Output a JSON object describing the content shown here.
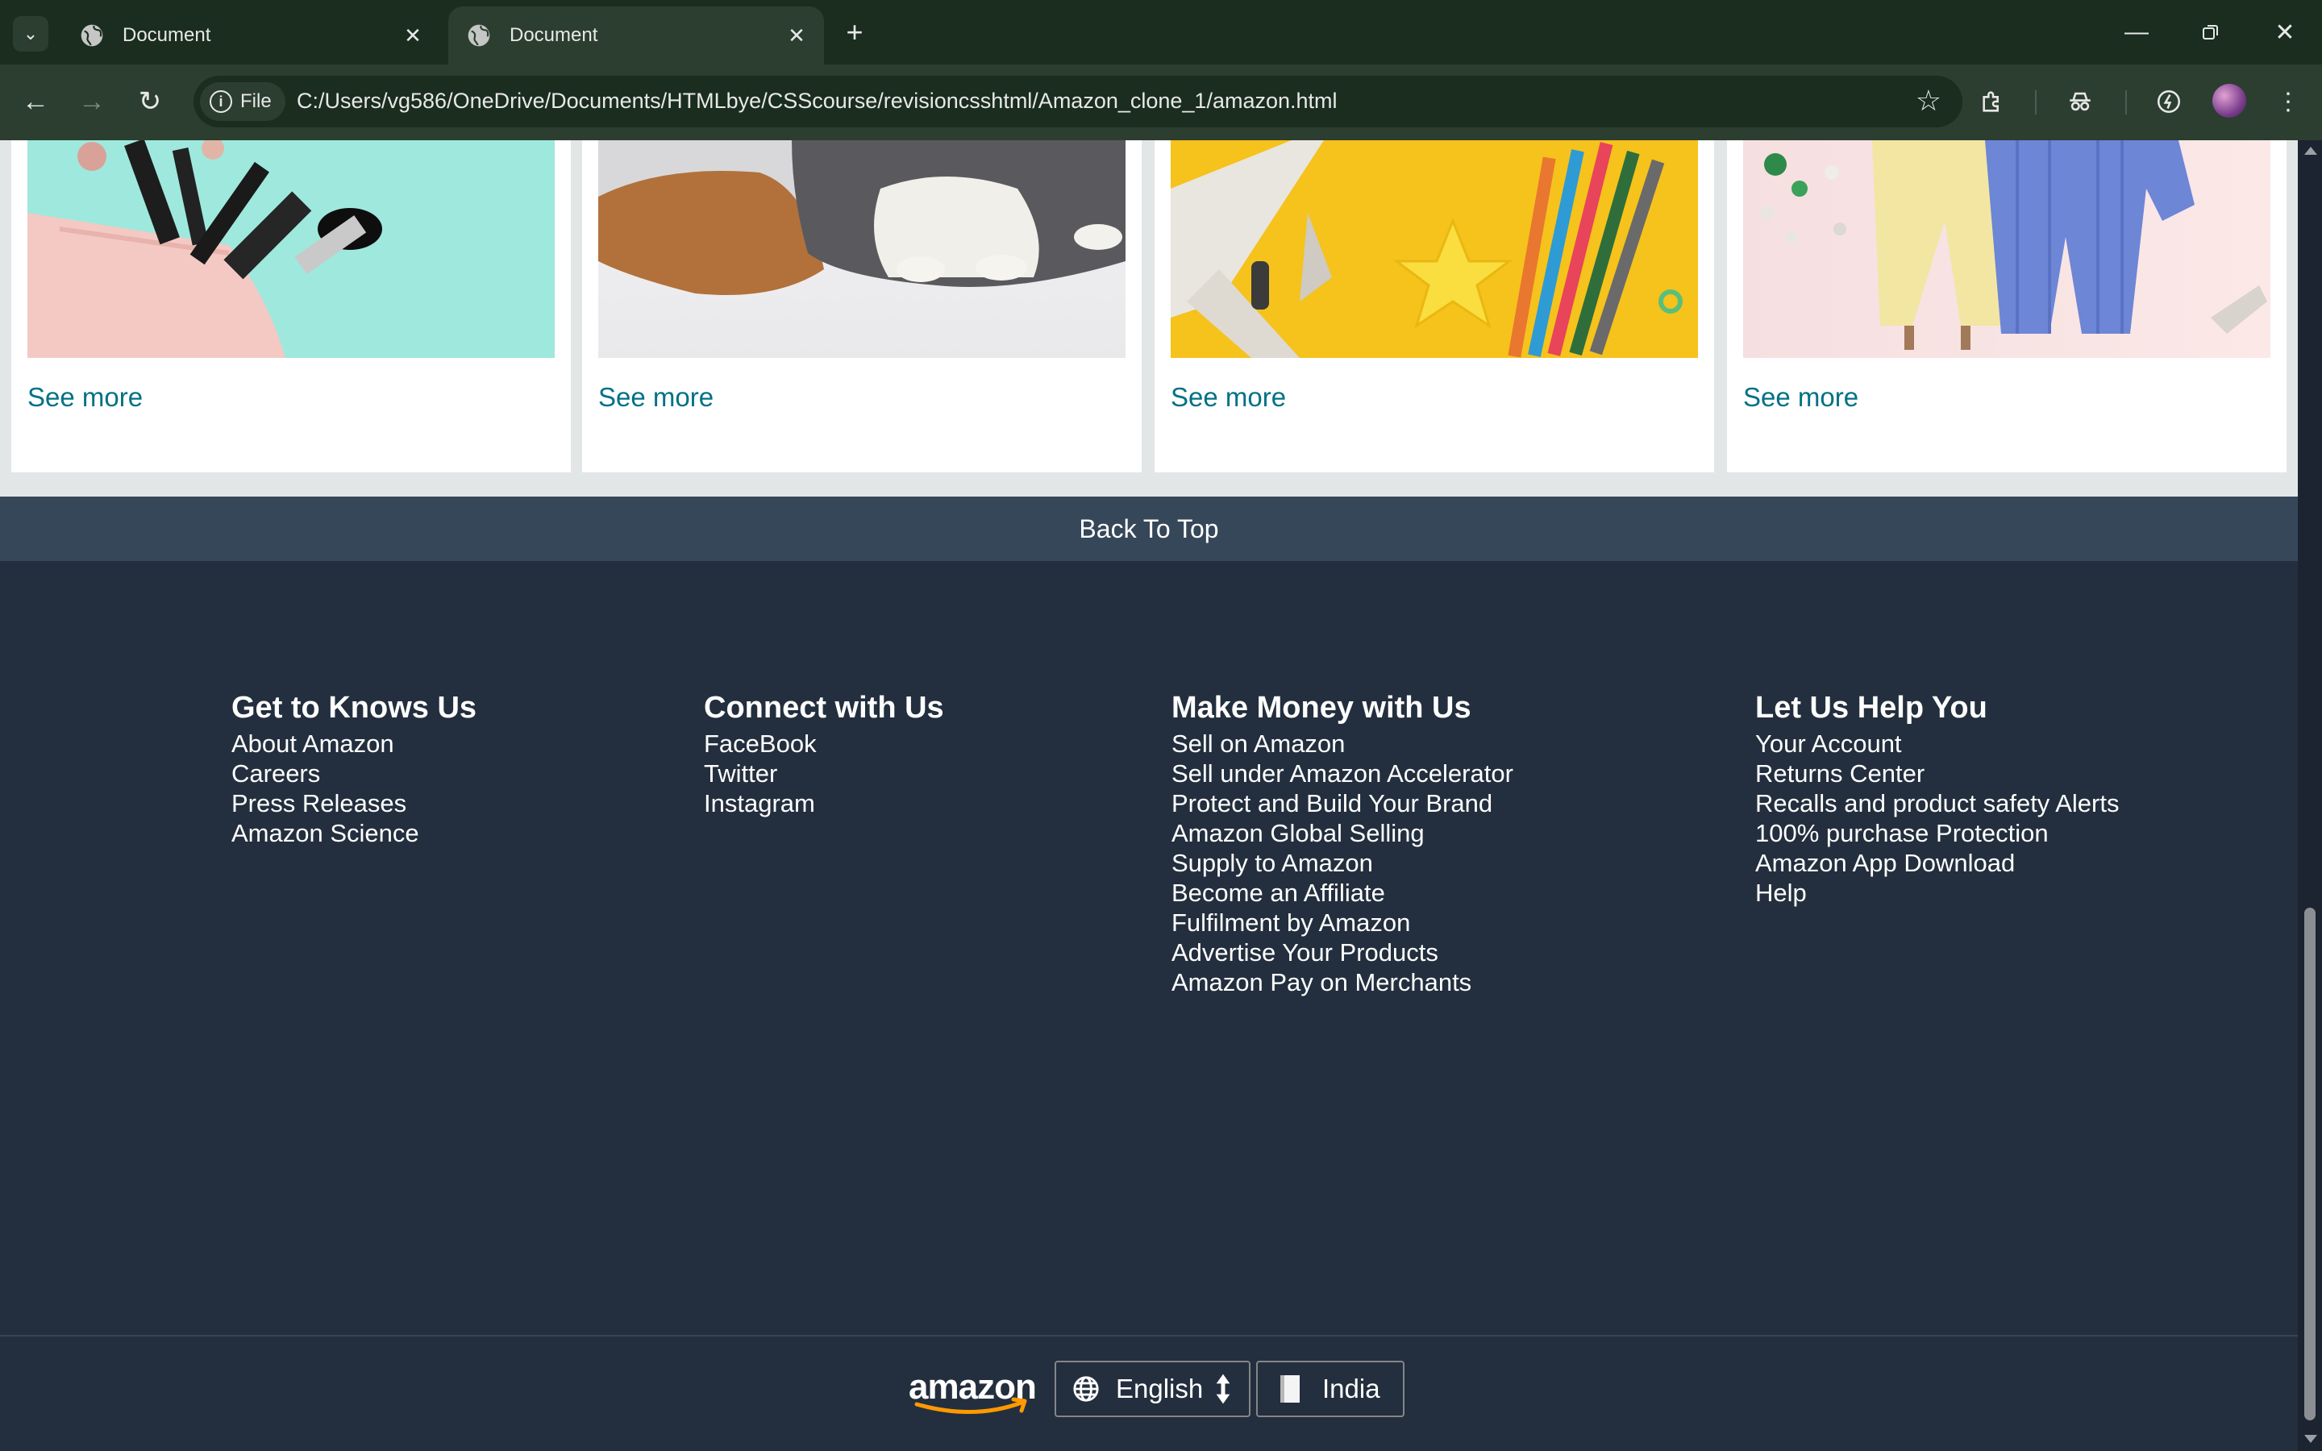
{
  "browser": {
    "tabs": [
      {
        "title": "Document",
        "active": false
      },
      {
        "title": "Document",
        "active": true
      }
    ],
    "site_chip": "File",
    "url": "C:/Users/vg586/OneDrive/Documents/HTMLbye/CSScourse/revisioncsshtml/Amazon_clone_1/amazon.html"
  },
  "cards": [
    {
      "image": "makeup-bag-brushes",
      "link": "See more"
    },
    {
      "image": "cat-on-floor",
      "link": "See more"
    },
    {
      "image": "toy-airplane-pencils",
      "link": "See more"
    },
    {
      "image": "women-fashion",
      "link": "See more"
    }
  ],
  "back_to_top": "Back To Top",
  "footer": {
    "columns": [
      {
        "title": "Get to Knows Us",
        "links": [
          "About Amazon",
          "Careers",
          "Press Releases",
          "Amazon Science"
        ]
      },
      {
        "title": "Connect with Us",
        "links": [
          "FaceBook",
          "Twitter",
          "Instagram"
        ]
      },
      {
        "title": "Make Money with Us",
        "links": [
          "Sell on Amazon",
          "Sell under Amazon Accelerator",
          "Protect and Build Your Brand",
          "Amazon Global Selling",
          "Supply to Amazon",
          "Become an Affiliate",
          "Fulfilment by Amazon",
          "Advertise Your Products",
          "Amazon Pay on Merchants"
        ]
      },
      {
        "title": "Let Us Help You",
        "links": [
          "Your Account",
          "Returns Center",
          "Recalls and product safety Alerts",
          "100% purchase Protection",
          "Amazon App Download",
          "Help"
        ]
      }
    ],
    "logo": "amazon",
    "language": "English",
    "country": "India"
  },
  "colors": {
    "link": "#007185",
    "footer_bg": "#232f3e",
    "back_to_top_bg": "#37475a",
    "page_bg": "#e3e6e6"
  }
}
